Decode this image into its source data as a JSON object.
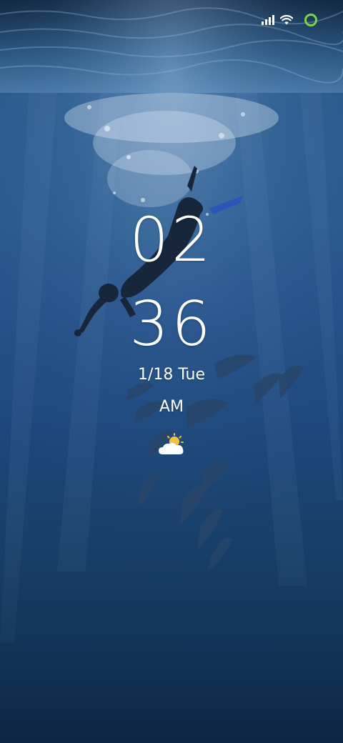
{
  "status_bar": {
    "signal_icon": "cellular-signal-icon",
    "wifi_icon": "wifi-icon",
    "battery_icon": "battery-ring-icon",
    "battery_color": "#7ed348"
  },
  "clock": {
    "hour": "02",
    "minute": "36"
  },
  "date": "1/18 Tue",
  "ampm": "AM",
  "weather": {
    "icon": "partly-cloudy-icon"
  },
  "wallpaper": {
    "icon": "underwater-diver-dolphins-wallpaper"
  }
}
